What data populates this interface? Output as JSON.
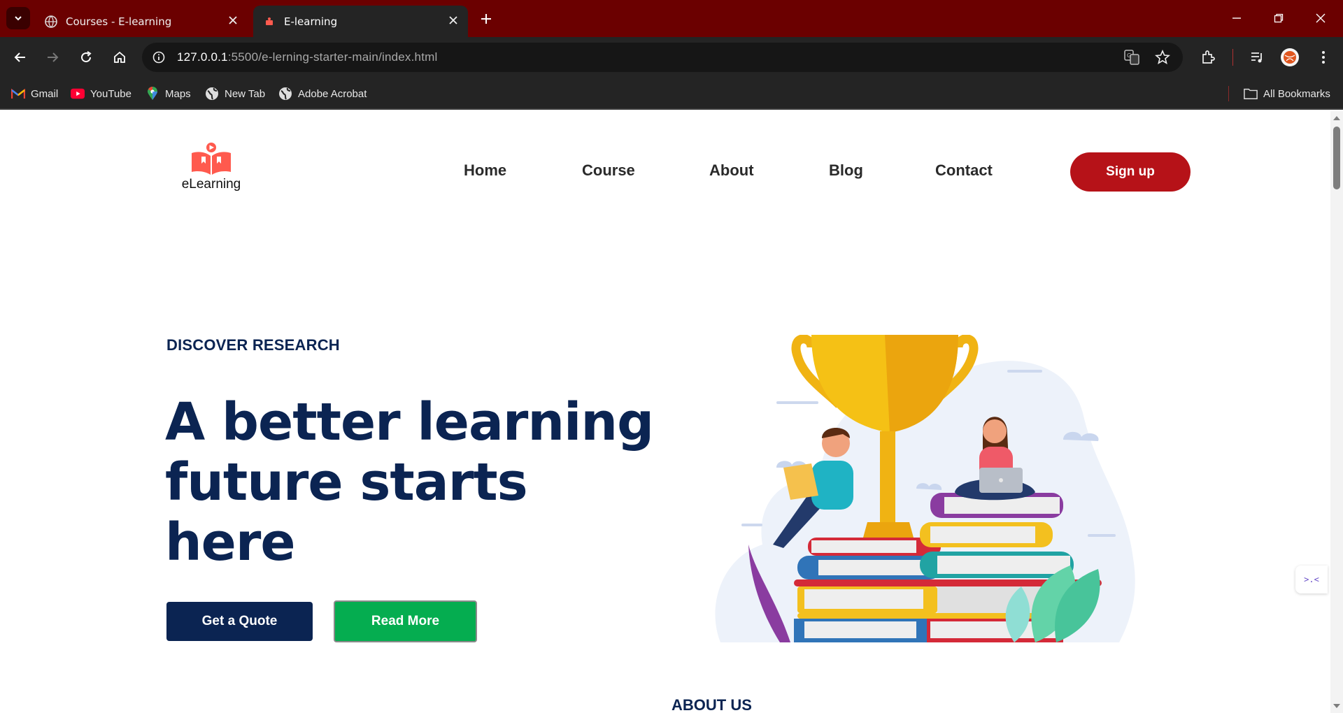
{
  "browser": {
    "tabs": [
      {
        "title": "Courses - E-learning",
        "active": false
      },
      {
        "title": "E-learning",
        "active": true
      }
    ],
    "url": {
      "host": "127.0.0.1",
      "rest": ":5500/e-lerning-starter-main/index.html"
    },
    "bookmarks": [
      {
        "label": "Gmail",
        "icon": "gmail-icon"
      },
      {
        "label": "YouTube",
        "icon": "youtube-icon"
      },
      {
        "label": "Maps",
        "icon": "maps-icon"
      },
      {
        "label": "New Tab",
        "icon": "globe-icon"
      },
      {
        "label": "Adobe Acrobat",
        "icon": "globe-icon"
      }
    ],
    "all_bookmarks_label": "All Bookmarks",
    "colors": {
      "tabstrip": "#6b0000",
      "toolbar": "#242424"
    }
  },
  "site": {
    "logo_text": "eLearning",
    "nav": [
      {
        "label": "Home"
      },
      {
        "label": "Course"
      },
      {
        "label": "About"
      },
      {
        "label": "Blog"
      },
      {
        "label": "Contact"
      }
    ],
    "signup_label": "Sign up",
    "colors": {
      "primary": "#0b2452",
      "accent_red": "#b61218",
      "accent_green": "#05ad50"
    }
  },
  "hero": {
    "eyebrow": "DISCOVER RESEARCH",
    "title_lines": [
      "A better learning",
      "future starts",
      "here"
    ],
    "primary_button": "Get a Quote",
    "secondary_button": "Read More"
  },
  "next_section": {
    "heading": "ABOUT US"
  }
}
